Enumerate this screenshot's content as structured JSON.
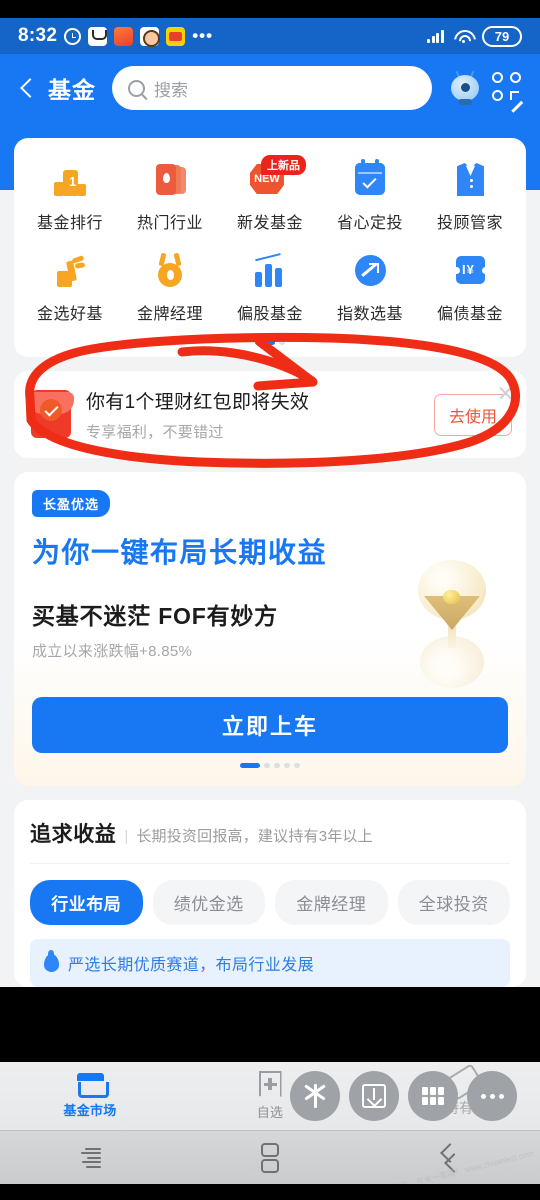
{
  "status_bar": {
    "time": "8:32",
    "battery": "79",
    "icons": [
      "alarm-icon",
      "app-notification-icon",
      "taobao-icon",
      "avatar-icon",
      "meituan-icon",
      "overflow-dots-icon",
      "signal-icon",
      "wifi-icon",
      "battery-icon"
    ]
  },
  "header": {
    "title": "基金",
    "search_placeholder": "搜索",
    "back_icon": "chevron-left-icon",
    "assistant_icon": "robot-assistant-icon",
    "scan_icon": "scan-code-icon"
  },
  "quick_grid": {
    "items": [
      {
        "label": "基金排行",
        "icon": "podium-rank-icon",
        "badge": ""
      },
      {
        "label": "热门行业",
        "icon": "flame-cards-icon",
        "badge": ""
      },
      {
        "label": "新发基金",
        "icon": "new-badge-icon",
        "badge": "上新品"
      },
      {
        "label": "省心定投",
        "icon": "calendar-check-icon",
        "badge": ""
      },
      {
        "label": "投顾管家",
        "icon": "suit-advisor-icon",
        "badge": ""
      },
      {
        "label": "金选好基",
        "icon": "hand-pick-icon",
        "badge": ""
      },
      {
        "label": "金牌经理",
        "icon": "gold-medal-icon",
        "badge": ""
      },
      {
        "label": "偏股基金",
        "icon": "bar-chart-trend-icon",
        "badge": ""
      },
      {
        "label": "指数选基",
        "icon": "circle-arrow-icon",
        "badge": ""
      },
      {
        "label": "偏债基金",
        "icon": "ticket-yuan-icon",
        "badge": ""
      }
    ],
    "new_icon_text": "NEW",
    "pager": {
      "total": 2,
      "active": 0
    }
  },
  "red_packet": {
    "title": "你有1个理财红包即将失效",
    "subtitle": "专享福利，不要错过",
    "button": "去使用",
    "icon": "red-envelope-icon",
    "close_icon": "close-icon"
  },
  "promo": {
    "tag": "长盈优选",
    "headline": "为你一键布局长期收益",
    "subhead": "买基不迷茫 FOF有妙方",
    "performance": "成立以来涨跌幅+8.85%",
    "cta": "立即上车",
    "illustration": "hourglass-icon",
    "pager": {
      "total": 5,
      "active": 0
    }
  },
  "pursue": {
    "title": "追求收益",
    "separator": "|",
    "subtitle": "长期投资回报高，建议持有3年以上",
    "tabs": [
      {
        "label": "行业布局",
        "active": true
      },
      {
        "label": "绩优金选",
        "active": false
      },
      {
        "label": "金牌经理",
        "active": false
      },
      {
        "label": "全球投资",
        "active": false
      }
    ],
    "note": "严选长期优质赛道，布局行业发展",
    "note_icon": "flame-icon"
  },
  "bottom_nav": {
    "items": [
      {
        "label": "基金市场",
        "icon": "shop-icon",
        "active": true
      },
      {
        "label": "自选",
        "icon": "bookmark-plus-icon",
        "active": false
      },
      {
        "label": "持有",
        "icon": "hold-icon",
        "active": false
      }
    ]
  },
  "floating_buttons": [
    {
      "icon": "sparkle-icon"
    },
    {
      "icon": "download-icon"
    },
    {
      "icon": "grid-apps-icon"
    },
    {
      "icon": "more-dots-icon"
    }
  ],
  "system_nav": {
    "menu_icon": "recents-menu-icon",
    "home_icon": "home-split-icon",
    "back_icon": "back-chevrons-icon"
  },
  "watermark": "精事宝，有省一笔哦！\nwww.zhuanlest.com",
  "annotation": {
    "type": "hand-drawn-circle-with-arrow",
    "color": "#ef2d16"
  },
  "colors": {
    "brand_blue": "#1877f2",
    "status_blue": "#1565c8",
    "orange": "#f6a623",
    "red": "#ef3a2a",
    "page_bg": "#f2f3f5"
  }
}
